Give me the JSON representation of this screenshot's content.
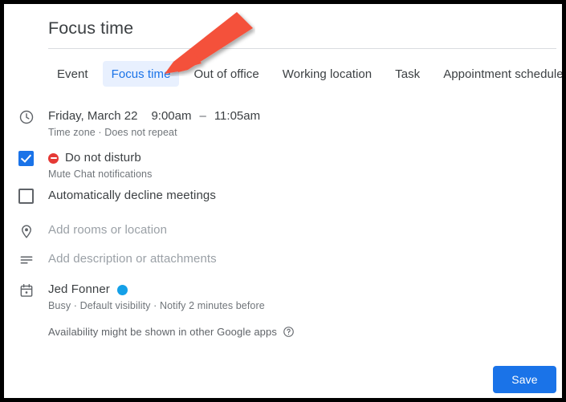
{
  "header": {
    "title": "Focus time"
  },
  "tabs": [
    {
      "label": "Event",
      "active": false
    },
    {
      "label": "Focus time",
      "active": true
    },
    {
      "label": "Out of office",
      "active": false
    },
    {
      "label": "Working location",
      "active": false
    },
    {
      "label": "Task",
      "active": false
    },
    {
      "label": "Appointment schedule",
      "active": false
    }
  ],
  "datetime": {
    "icon": "clock-icon",
    "date": "Friday, March 22",
    "start_time": "9:00am",
    "dash": "–",
    "end_time": "11:05am",
    "subtitle": "Time zone · Does not repeat"
  },
  "do_not_disturb": {
    "checkbox_state": "checked",
    "status_icon": "do-not-disturb-icon",
    "label": "Do not disturb",
    "subtitle": "Mute Chat notifications"
  },
  "auto_decline": {
    "checkbox_state": "unchecked",
    "label": "Automatically decline meetings"
  },
  "location": {
    "icon": "location-pin-icon",
    "placeholder": "Add rooms or location"
  },
  "description": {
    "icon": "description-lines-icon",
    "placeholder": "Add description or attachments"
  },
  "calendar": {
    "icon": "calendar-icon",
    "owner": "Jed Fonner",
    "color_dot": "#14a0e8",
    "subtitle": "Busy · Default visibility · Notify 2 minutes before"
  },
  "availability": {
    "text": "Availability might be shown in other Google apps",
    "help_icon": "help-circle-icon"
  },
  "footer": {
    "save_label": "Save"
  },
  "annotation": {
    "type": "arrow",
    "color": "#f4513b",
    "points_to": "Focus time"
  },
  "colors": {
    "accent": "#1a73e8",
    "active_tab_bg": "#e8f0fe",
    "dnd_red": "#e53935",
    "annotation_red": "#f4513b",
    "text_primary": "#3c4043",
    "text_secondary": "#70757a",
    "placeholder": "#9aa0a6"
  }
}
